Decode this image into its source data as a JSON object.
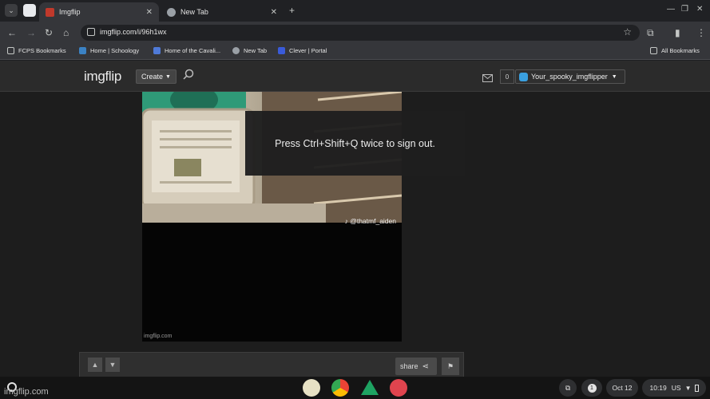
{
  "browser": {
    "tabs": [
      {
        "title": "Imgflip",
        "active": true,
        "favicon_color": "#c0392b"
      },
      {
        "title": "New Tab",
        "active": false,
        "favicon_color": "#9aa0a6"
      }
    ],
    "new_tab_icon": "plus-icon",
    "url": "imgflip.com/i/96h1wx"
  },
  "bookmarks": [
    {
      "label": "FCPS Bookmarks",
      "icon": "folder-icon",
      "color": "#c4c7c5"
    },
    {
      "label": "Home | Schoology",
      "icon": "schoology-icon",
      "color": "#3b82c4"
    },
    {
      "label": "Home of the Cavali...",
      "icon": "cavalier-icon",
      "color": "#4f7ad8"
    },
    {
      "label": "New Tab",
      "icon": "globe-icon",
      "color": "#9aa0a6"
    },
    {
      "label": "Clever | Portal",
      "icon": "clever-icon",
      "color": "#3a5bd9"
    }
  ],
  "all_bookmarks_label": "All Bookmarks",
  "imgflip": {
    "logo_text": "imgflip",
    "create_label": "Create",
    "notification_count": "0",
    "username": "Your_spooky_imgflipper"
  },
  "video": {
    "watermark": "imgflip.com",
    "tiktok_handle": "@thatmf_aiden"
  },
  "toast_message": "Press Ctrl+Shift+Q twice to sign out.",
  "vote_bar": {
    "share_label": "share"
  },
  "shelf": {
    "notification_count": "1",
    "date": "Oct 12",
    "time": "10:19",
    "locale": "US"
  },
  "page_watermark": "imgflip.com",
  "colors": {
    "brand": "#eaeaea",
    "accent_blue": "#8ab4f8"
  }
}
